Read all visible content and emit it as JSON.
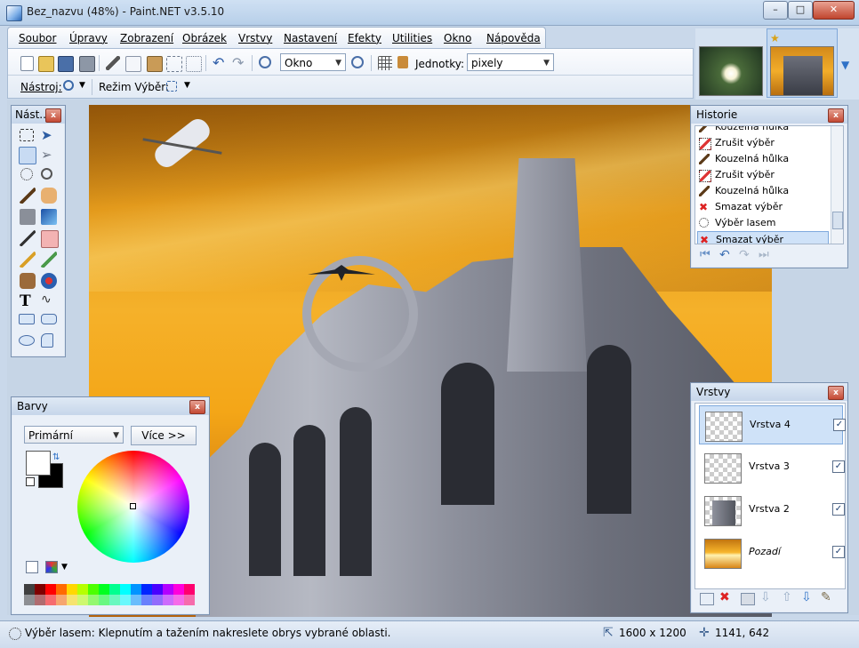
{
  "window": {
    "title": "Bez_nazvu (48%) - Paint.NET v3.5.10",
    "minimize_label": "–",
    "maximize_label": "□",
    "close_label": "✕"
  },
  "menu": [
    "Soubor",
    "Úpravy",
    "Zobrazení",
    "Obrázek",
    "Vrstvy",
    "Nastavení",
    "Efekty",
    "Utilities",
    "Okno",
    "Nápověda"
  ],
  "toolbar": {
    "zoom_value": "Okno",
    "units_label": "Jednotky:",
    "units_value": "pixely",
    "tool_label": "Nástroj:",
    "selection_mode_label": "Režim Výběr:"
  },
  "thumbnails": [
    "flower-image-thumbnail",
    "building-image-thumbnail"
  ],
  "tools_panel": {
    "title": "Nást..."
  },
  "history_panel": {
    "title": "Historie",
    "items": [
      {
        "label": "Kouzelná hůlka",
        "icon": "magic-wand-icon"
      },
      {
        "label": "Zrušit výběr",
        "icon": "deselect-icon"
      },
      {
        "label": "Kouzelná hůlka",
        "icon": "magic-wand-icon"
      },
      {
        "label": "Zrušit výběr",
        "icon": "deselect-icon"
      },
      {
        "label": "Kouzelná hůlka",
        "icon": "magic-wand-icon"
      },
      {
        "label": "Smazat výběr",
        "icon": "delete-icon"
      },
      {
        "label": "Výběr lasem",
        "icon": "lasso-icon"
      },
      {
        "label": "Smazat výběr",
        "icon": "delete-icon"
      }
    ],
    "selected_index": 7
  },
  "colors_panel": {
    "title": "Barvy",
    "mode_value": "Primární",
    "more_label": "Více >>",
    "palette": [
      "#3f3f3f",
      "#7f0000",
      "#ff0000",
      "#ff6a00",
      "#ffd800",
      "#b6ff00",
      "#4cff00",
      "#00ff21",
      "#00ff90",
      "#00ffff",
      "#0094ff",
      "#0026ff",
      "#4800ff",
      "#b200ff",
      "#ff00dc",
      "#ff006e"
    ],
    "primary_color": "#ffffff",
    "secondary_color": "#000000"
  },
  "layers_panel": {
    "title": "Vrstvy",
    "layers": [
      {
        "name": "Vrstva 4",
        "visible": true,
        "selected": true
      },
      {
        "name": "Vrstva 3",
        "visible": true,
        "selected": false
      },
      {
        "name": "Vrstva 2",
        "visible": true,
        "selected": false
      },
      {
        "name": "Pozadí",
        "visible": true,
        "selected": false
      }
    ]
  },
  "status": {
    "message": "Výběr lasem: Klepnutím a tažením nakreslete obrys vybrané oblasti.",
    "image_size": "1600 x 1200",
    "cursor_position": "1141, 642"
  }
}
